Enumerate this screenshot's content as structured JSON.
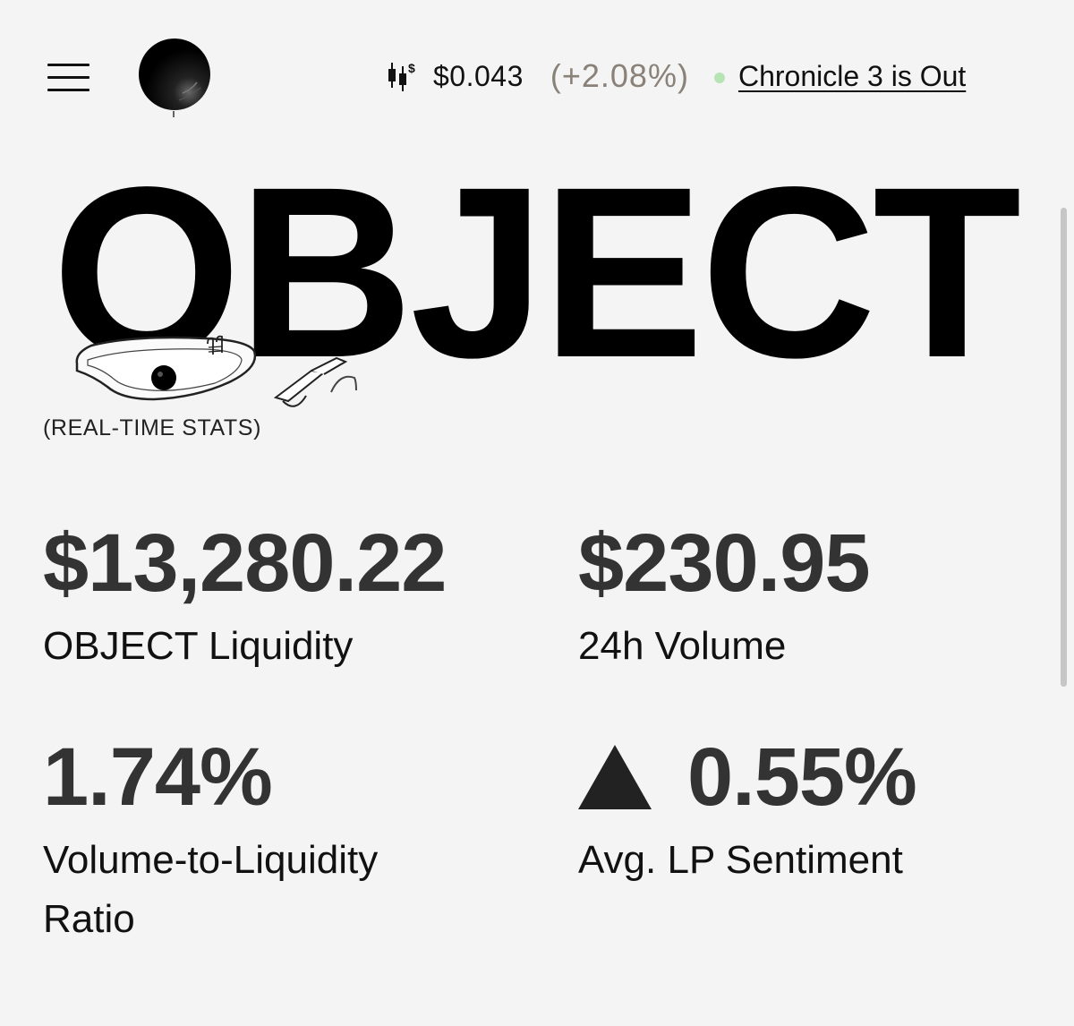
{
  "header": {
    "menu_icon": "hamburger-menu-icon",
    "logo_icon": "black-sphere-logo",
    "ticker_icon": "candlestick-dollar-icon",
    "price": "$0.043",
    "change": "(+2.08%)",
    "status_dot_color": "#b7e4b5",
    "news_link": "Chronicle 3 is Out"
  },
  "hero": {
    "title": "OBJECT",
    "subtitle": "(REAL-TIME STATS)"
  },
  "stats": [
    {
      "value": "$13,280.22",
      "label": "OBJECT Liquidity"
    },
    {
      "value": "$230.95",
      "label": "24h Volume"
    },
    {
      "value": "1.74%",
      "label": "Volume-to-Liquidity Ratio"
    },
    {
      "value": "0.55%",
      "label": "Avg. LP Sentiment",
      "trend_icon": "up-triangle-icon"
    }
  ]
}
